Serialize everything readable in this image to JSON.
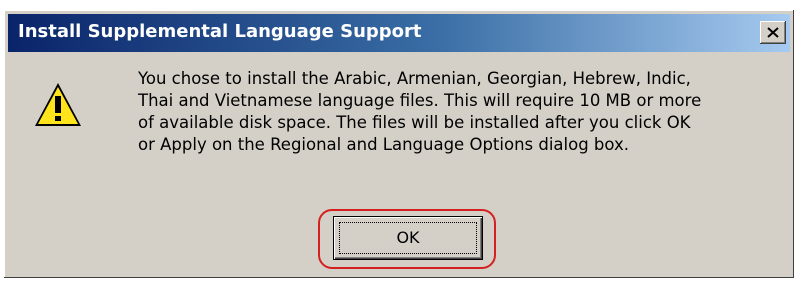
{
  "dialog": {
    "title": "Install Supplemental Language Support",
    "message": "You chose to install the Arabic, Armenian, Georgian, Hebrew, Indic,\nThai and Vietnamese language files. This will require 10 MB or more\nof available disk space. The files will be installed after you click OK\nor Apply on the Regional and Language Options dialog box.",
    "ok_label": "OK",
    "icon": "warning-icon"
  },
  "colors": {
    "title_bar_start": "#0a246a",
    "title_bar_end": "#a6caf0",
    "dialog_bg": "#d4d0c8",
    "highlight": "#d42020"
  }
}
